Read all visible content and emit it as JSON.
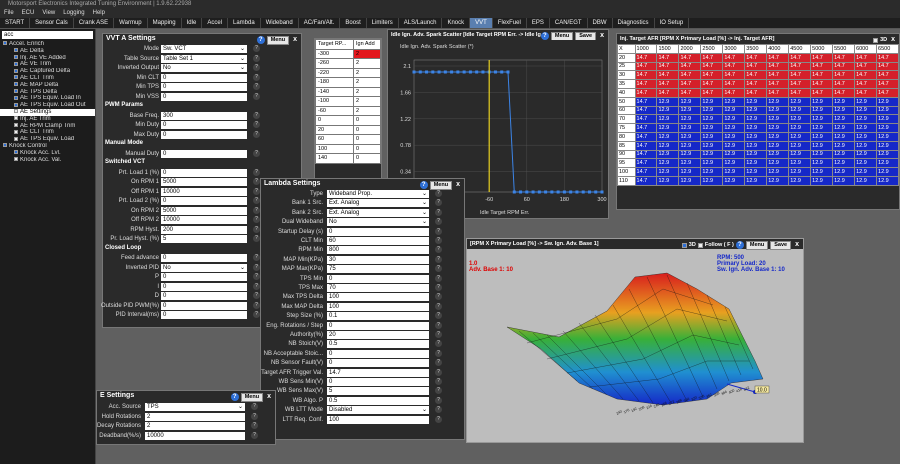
{
  "window_title": "Motorsport Electronics Integrated Tuning Environment | 1.9.62.22938",
  "menu": [
    "File",
    "ECU",
    "View",
    "Logging",
    "Help"
  ],
  "tabs": [
    "START",
    "Sensor Cals",
    "Crank ASE",
    "Warmup",
    "Mapping",
    "Idle",
    "Accel",
    "Lambda",
    "Wideband",
    "AC/Fan/Alt.",
    "Boost",
    "Limiters",
    "ALS/Launch",
    "Knock",
    "VVT",
    "FlexFuel",
    "EPS",
    "CAN/EGT",
    "DBW",
    "Diagnostics",
    "IO Setup"
  ],
  "active_tab": "VVT",
  "search_value": "acc",
  "tree": [
    {
      "label": "Accel. Enrich",
      "level": 0,
      "checked": true
    },
    {
      "label": "AE Delta",
      "level": 1,
      "checked": true
    },
    {
      "label": "Inj. AE VE Added",
      "level": 1,
      "checked": true
    },
    {
      "label": "AE VE Trim",
      "level": 1,
      "checked": true
    },
    {
      "label": "AE Captured Delta",
      "level": 1,
      "checked": true
    },
    {
      "label": "AE CLT Trim",
      "level": 1,
      "checked": true
    },
    {
      "label": "AE MAP Delta",
      "level": 1,
      "checked": true
    },
    {
      "label": "AE TPS Delta",
      "level": 1,
      "checked": true
    },
    {
      "label": "AE TPS Equiv. Load In",
      "level": 1,
      "checked": true
    },
    {
      "label": "AE TPS Equiv. Load Out",
      "level": 1,
      "checked": true
    },
    {
      "label": "AE Settings",
      "level": 1,
      "checked": false,
      "selected": true
    },
    {
      "label": "Inj. AE Trim",
      "level": 1,
      "checked": false
    },
    {
      "label": "AE RPM Clamp Trim",
      "level": 1,
      "checked": false
    },
    {
      "label": "AE CLT Trim",
      "level": 1,
      "checked": false
    },
    {
      "label": "AE TPS Equiv. Load",
      "level": 1,
      "checked": false
    },
    {
      "label": "Knock Control",
      "level": 0,
      "checked": true
    },
    {
      "label": "Knock Acc. Lvl.",
      "level": 1,
      "checked": true
    },
    {
      "label": "Knock Acc. Val.",
      "level": 1,
      "checked": false
    }
  ],
  "vvt": {
    "title": "VVT A Settings",
    "menu_label": "Menu",
    "close": "x",
    "rows": [
      {
        "label": "Mode",
        "value": "Sw. VCT",
        "dropdown": true
      },
      {
        "label": "Table Source",
        "value": "Table Set 1",
        "dropdown": true
      },
      {
        "label": "Inverted Output",
        "value": "No",
        "dropdown": true
      },
      {
        "label": "Min CLT",
        "value": "0"
      },
      {
        "label": "Min TPS",
        "value": "0"
      },
      {
        "label": "Min VSS",
        "value": "0"
      },
      {
        "section": "PWM Params"
      },
      {
        "label": "Base Freq.",
        "value": "300"
      },
      {
        "label": "Min Duty",
        "value": "0"
      },
      {
        "label": "Max Duty",
        "value": "0"
      },
      {
        "section": "Manual Mode"
      },
      {
        "label": "Manual Duty",
        "value": "0"
      },
      {
        "section": "Switched VCT"
      },
      {
        "label": "Prt. Load 1 (%)",
        "value": "0"
      },
      {
        "label": "On RPM 1",
        "value": "5000"
      },
      {
        "label": "Off RPM 1",
        "value": "10000"
      },
      {
        "label": "Prt. Load 2 (%)",
        "value": "0"
      },
      {
        "label": "On RPM 2",
        "value": "5000"
      },
      {
        "label": "Off RPM 2",
        "value": "10000"
      },
      {
        "label": "RPM Hyst.",
        "value": "200"
      },
      {
        "label": "Pr. Load Hyst. (%)",
        "value": "5"
      },
      {
        "section": "Closed Loop"
      },
      {
        "label": "Feed advance",
        "value": "0"
      },
      {
        "label": "Inverted PID",
        "value": "No",
        "dropdown": true
      },
      {
        "label": "P",
        "value": "0"
      },
      {
        "label": "I",
        "value": "0"
      },
      {
        "label": "D",
        "value": "0"
      },
      {
        "label": "Outside PID PWM(%)",
        "value": "0"
      },
      {
        "label": "PID Interval(ms)",
        "value": "0"
      }
    ]
  },
  "target_rpm": {
    "title": "Target RP...",
    "col1": "Target RP...",
    "col2": "Ign Add",
    "rows": [
      [
        "-300",
        "2"
      ],
      [
        "-260",
        "2"
      ],
      [
        "-220",
        "2"
      ],
      [
        "-180",
        "2"
      ],
      [
        "-140",
        "2"
      ],
      [
        "-100",
        "2"
      ],
      [
        "-60",
        "2"
      ],
      [
        "0",
        "0"
      ],
      [
        "20",
        "0"
      ],
      [
        "60",
        "0"
      ],
      [
        "100",
        "0"
      ],
      [
        "140",
        "0"
      ]
    ]
  },
  "idle_chart": {
    "title": "Idle Ign. Adv. Spark Scatter [Idle Target RPM Err. -> Idle Ign. Adv. Spark Scatter [*]]",
    "menu_label": "Menu",
    "save_label": "Save",
    "close": "x",
    "xlabel": "Idle Target RPM Err.",
    "ylabel": "Idle Ign. Adv. Spark Scatter (*)"
  },
  "chart_data": {
    "type": "line",
    "x": [
      -300,
      -280,
      -260,
      -240,
      -220,
      -200,
      -180,
      -160,
      -140,
      -120,
      -100,
      -80,
      -60,
      -40,
      -20,
      0,
      20,
      40,
      60,
      80,
      100,
      120,
      140,
      160,
      180,
      200,
      220,
      240,
      260,
      280,
      300
    ],
    "y": [
      2,
      2,
      2,
      2,
      2,
      2,
      2,
      2,
      2,
      2,
      2,
      2,
      2,
      2,
      2,
      2,
      0,
      0,
      0,
      0,
      0,
      0,
      0,
      0,
      0,
      0,
      0,
      0,
      0,
      0,
      0
    ],
    "title": "Idle Ign. Adv. Spark Scatter (*)",
    "xlabel": "Idle Target RPM Err.",
    "ylabel": "",
    "xticks": [
      "-60",
      "60",
      "180",
      "300"
    ],
    "yticks": [
      "2.1",
      "1.66",
      "1.22",
      "0.78",
      "0.34"
    ],
    "xlim": [
      -300,
      300
    ],
    "ylim": [
      0,
      2.2
    ]
  },
  "afr": {
    "title": "Inj. Target AFR [RPM X Primary Load [%] -> Inj. Target AFR]",
    "check3d": "3D",
    "close": "x",
    "cols": [
      "X",
      "1000",
      "1500",
      "2000",
      "2500",
      "3000",
      "3500",
      "4000",
      "4500",
      "5000",
      "5500",
      "6000",
      "6500"
    ],
    "rows": [
      {
        "load": "20",
        "v": [
          "14.7",
          "14.7",
          "14.7",
          "14.7",
          "14.7",
          "14.7",
          "14.7",
          "14.7",
          "14.7",
          "14.7",
          "14.7",
          "14.7"
        ],
        "c": "red"
      },
      {
        "load": "25",
        "v": [
          "14.7",
          "14.7",
          "14.7",
          "14.7",
          "14.7",
          "14.7",
          "14.7",
          "14.7",
          "14.7",
          "14.7",
          "14.7",
          "14.7"
        ],
        "c": "red"
      },
      {
        "load": "30",
        "v": [
          "14.7",
          "14.7",
          "14.7",
          "14.7",
          "14.7",
          "14.7",
          "14.7",
          "14.7",
          "14.7",
          "14.7",
          "14.7",
          "14.7"
        ],
        "c": "red"
      },
      {
        "load": "35",
        "v": [
          "14.7",
          "14.7",
          "14.7",
          "14.7",
          "14.7",
          "14.7",
          "14.7",
          "14.7",
          "14.7",
          "14.7",
          "14.7",
          "14.7"
        ],
        "c": "red"
      },
      {
        "load": "40",
        "v": [
          "14.7",
          "14.7",
          "14.7",
          "14.7",
          "14.7",
          "14.7",
          "14.7",
          "14.7",
          "14.7",
          "14.7",
          "14.7",
          "14.7"
        ],
        "c": "red"
      },
      {
        "load": "50",
        "v": [
          "14.7",
          "12.9",
          "12.9",
          "12.9",
          "12.9",
          "12.9",
          "12.9",
          "12.9",
          "12.9",
          "12.9",
          "12.9",
          "12.9"
        ],
        "c": "blue"
      },
      {
        "load": "60",
        "v": [
          "14.7",
          "12.9",
          "12.9",
          "12.9",
          "12.9",
          "12.9",
          "12.9",
          "12.9",
          "12.9",
          "12.9",
          "12.9",
          "12.9"
        ],
        "c": "blue"
      },
      {
        "load": "70",
        "v": [
          "14.7",
          "12.9",
          "12.9",
          "12.9",
          "12.9",
          "12.9",
          "12.9",
          "12.9",
          "12.9",
          "12.9",
          "12.9",
          "12.9"
        ],
        "c": "blue"
      },
      {
        "load": "75",
        "v": [
          "14.7",
          "12.9",
          "12.9",
          "12.9",
          "12.9",
          "12.9",
          "12.9",
          "12.9",
          "12.9",
          "12.9",
          "12.9",
          "12.9"
        ],
        "c": "blue"
      },
      {
        "load": "80",
        "v": [
          "14.7",
          "12.9",
          "12.9",
          "12.9",
          "12.9",
          "12.9",
          "12.9",
          "12.9",
          "12.9",
          "12.9",
          "12.9",
          "12.9"
        ],
        "c": "blue"
      },
      {
        "load": "85",
        "v": [
          "14.7",
          "12.9",
          "12.9",
          "12.9",
          "12.9",
          "12.9",
          "12.9",
          "12.9",
          "12.9",
          "12.9",
          "12.9",
          "12.9"
        ],
        "c": "blue"
      },
      {
        "load": "90",
        "v": [
          "14.7",
          "12.9",
          "12.9",
          "12.9",
          "12.9",
          "12.9",
          "12.9",
          "12.9",
          "12.9",
          "12.9",
          "12.9",
          "12.9"
        ],
        "c": "blue"
      },
      {
        "load": "95",
        "v": [
          "14.7",
          "12.9",
          "12.9",
          "12.9",
          "12.9",
          "12.9",
          "12.9",
          "12.9",
          "12.9",
          "12.9",
          "12.9",
          "12.9"
        ],
        "c": "blue"
      },
      {
        "load": "100",
        "v": [
          "14.7",
          "12.9",
          "12.9",
          "12.9",
          "12.9",
          "12.9",
          "12.9",
          "12.9",
          "12.9",
          "12.9",
          "12.9",
          "12.9"
        ],
        "c": "blue"
      },
      {
        "load": "110",
        "v": [
          "14.7",
          "12.9",
          "12.9",
          "12.9",
          "12.9",
          "12.9",
          "12.9",
          "12.9",
          "12.9",
          "12.9",
          "12.9",
          "12.9"
        ],
        "c": "blue"
      }
    ]
  },
  "lambda": {
    "title": "Lambda Settings",
    "menu_label": "Menu",
    "close": "x",
    "rows": [
      {
        "label": "Type",
        "value": "Wideband Prop.",
        "dropdown": true
      },
      {
        "label": "Bank 1 Src.",
        "value": "Ext. Analog",
        "dropdown": true
      },
      {
        "label": "Bank 2 Src.",
        "value": "Ext. Analog",
        "dropdown": true
      },
      {
        "label": "Dual Wideband",
        "value": "No",
        "dropdown": true
      },
      {
        "label": "Startup Delay (s)",
        "value": "0"
      },
      {
        "label": "CLT Min",
        "value": "60"
      },
      {
        "label": "RPM Min",
        "value": "800"
      },
      {
        "label": "MAP Min(KPa)",
        "value": "30"
      },
      {
        "label": "MAP Max(KPa)",
        "value": "75"
      },
      {
        "label": "TPS Min",
        "value": "0"
      },
      {
        "label": "TPS Max",
        "value": "70"
      },
      {
        "label": "Max TPS Delta",
        "value": "100"
      },
      {
        "label": "Max MAP Delta",
        "value": "100"
      },
      {
        "label": "Step Size (%)",
        "value": "0.1"
      },
      {
        "label": "Eng. Rotations / Step",
        "value": "0"
      },
      {
        "label": "Authority(%)",
        "value": "20"
      },
      {
        "label": "NB Stoich(V)",
        "value": "0.5"
      },
      {
        "label": "NB Acceptable Stoic...",
        "value": "0"
      },
      {
        "label": "NB Sensor Fault(V)",
        "value": "0"
      },
      {
        "label": "Target AFR Trigger Val.",
        "value": "14.7"
      },
      {
        "label": "WB Sens Min(V)",
        "value": "0"
      },
      {
        "label": "WB Sens Max(V)",
        "value": "5"
      },
      {
        "label": "WB Algo. P",
        "value": "0.5"
      },
      {
        "label": "WB LTT Mode",
        "value": "Disabled",
        "dropdown": true
      },
      {
        "label": "LTT Req. Conf.",
        "value": "100"
      }
    ]
  },
  "ae": {
    "title": "E Settings",
    "menu_label": "Menu",
    "close": "x",
    "rows": [
      {
        "label": "Acc. Source",
        "value": "TPS",
        "dropdown": true
      },
      {
        "label": "Hold Rotations",
        "value": "2"
      },
      {
        "label": "Decay Rotations",
        "value": "2"
      },
      {
        "label": "Deadband(%/s)",
        "value": "10000"
      }
    ]
  },
  "surface": {
    "title": "[RPM X Primary Load [%] -> Sw. Ign. Adv. Base 1]",
    "check3d": "3D",
    "follow": "Follow ( F )",
    "menu_label": "Menu",
    "save_label": "Save",
    "close": "x",
    "partial_label_1": "1.0",
    "partial_label_2": "Adv. Base 1: 10",
    "info_rpm": "RPM: 500",
    "info_load": "Primary Load: 20",
    "info_adv": "Sw. Ign. Adv. Base 1: 10",
    "cursor_value": "10.0",
    "axis_ticks": [
      "240",
      "176",
      "192",
      "208",
      "224",
      "240",
      "256",
      "272",
      "288",
      "304",
      "320",
      "336",
      "352",
      "368",
      "384",
      "400",
      "416",
      "432"
    ]
  }
}
